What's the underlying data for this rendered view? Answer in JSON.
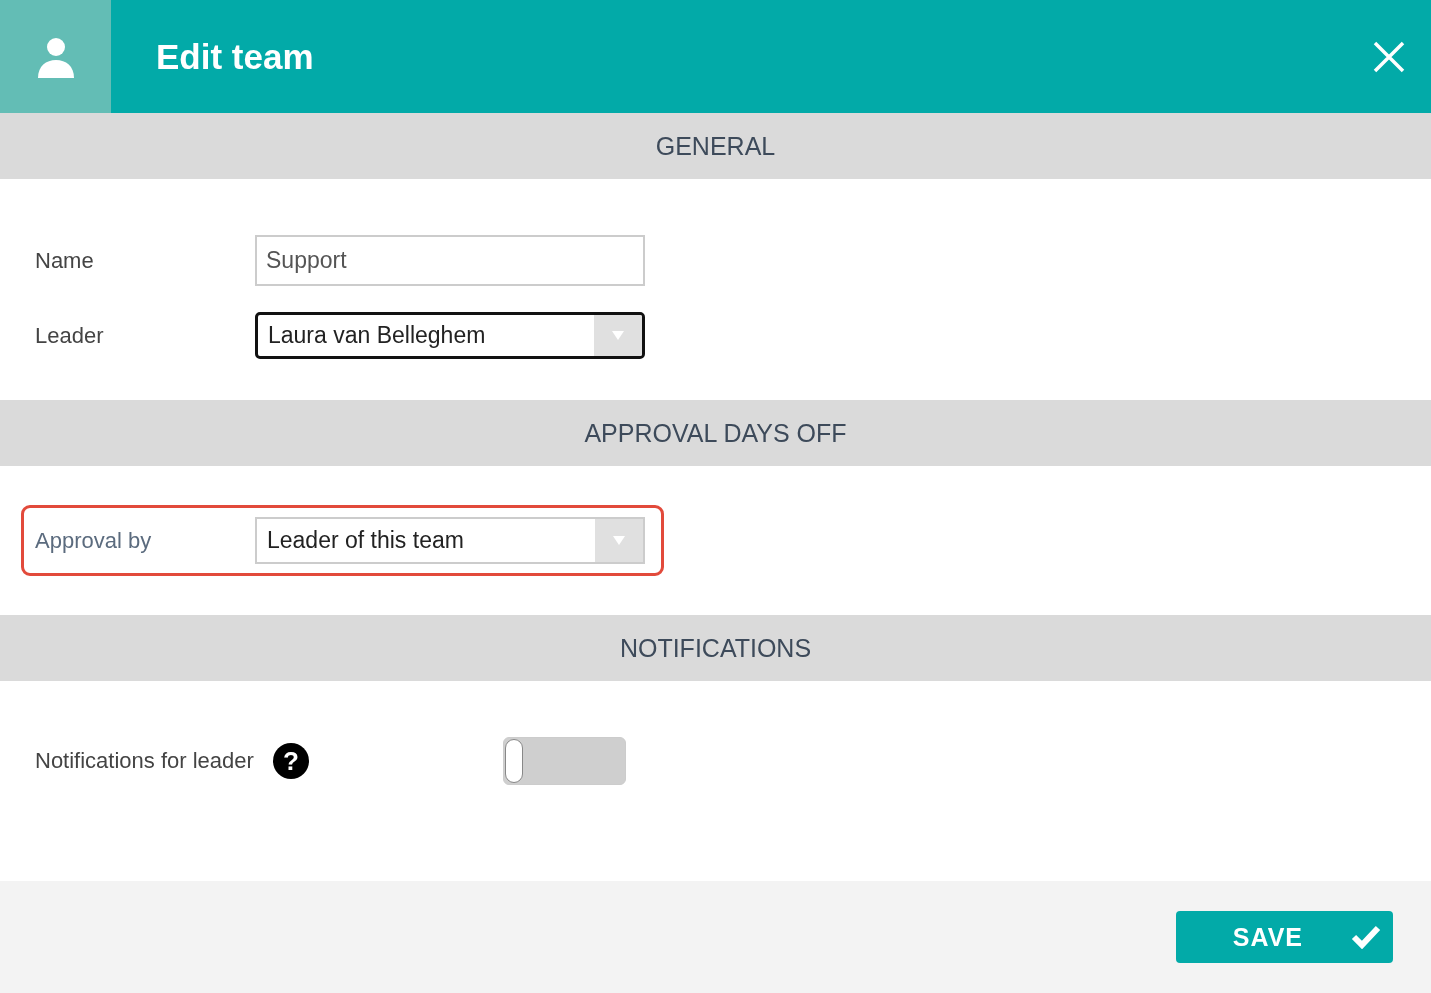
{
  "header": {
    "title": "Edit team"
  },
  "sections": [
    {
      "title": "GENERAL",
      "fields": [
        {
          "kind": "text",
          "label": "Name",
          "value": "Support",
          "focused": false,
          "highlighted": false
        },
        {
          "kind": "select",
          "label": "Leader",
          "value": "Laura van Belleghem",
          "focused": true,
          "highlighted": false
        }
      ]
    },
    {
      "title": "APPROVAL DAYS OFF",
      "fields": [
        {
          "kind": "select",
          "label": "Approval by",
          "value": "Leader of this team",
          "focused": false,
          "highlighted": true
        }
      ]
    },
    {
      "title": "NOTIFICATIONS",
      "fields": [
        {
          "kind": "toggle",
          "label": "Notifications for leader",
          "help": "?",
          "on": false,
          "highlighted": false
        }
      ]
    }
  ],
  "footer": {
    "button": "SAVE"
  }
}
